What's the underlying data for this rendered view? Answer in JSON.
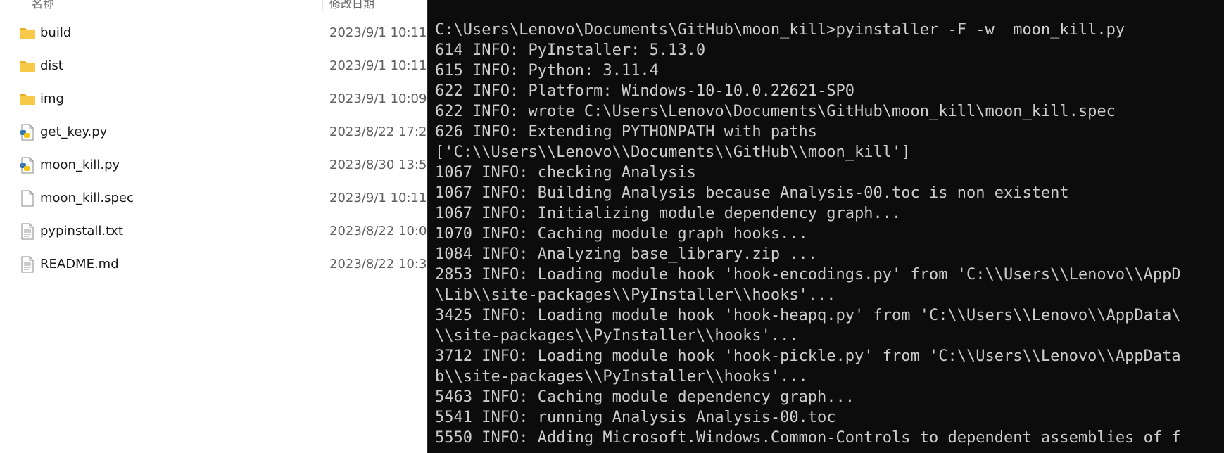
{
  "explorer": {
    "header": {
      "name_col": "名称",
      "date_col": "修改日期"
    },
    "files": [
      {
        "name": "build",
        "date": "2023/9/1 10:11",
        "icon": "folder-icon"
      },
      {
        "name": "dist",
        "date": "2023/9/1 10:11",
        "icon": "folder-icon"
      },
      {
        "name": "img",
        "date": "2023/9/1 10:09",
        "icon": "folder-icon"
      },
      {
        "name": "get_key.py",
        "date": "2023/8/22 17:2",
        "icon": "python-file-icon"
      },
      {
        "name": "moon_kill.py",
        "date": "2023/8/30 13:5",
        "icon": "python-file-icon"
      },
      {
        "name": "moon_kill.spec",
        "date": "2023/9/1 10:11",
        "icon": "file-icon"
      },
      {
        "name": "pypinstall.txt",
        "date": "2023/8/22 10:0",
        "icon": "text-file-icon"
      },
      {
        "name": "README.md",
        "date": "2023/8/22 10:3",
        "icon": "text-file-icon"
      }
    ],
    "colors": {
      "folder": "#f8c948",
      "folder_dark": "#e9b02a",
      "python_blue": "#3a76b0",
      "python_yellow": "#f5c518"
    }
  },
  "terminal": {
    "lines": [
      "C:\\Users\\Lenovo\\Documents\\GitHub\\moon_kill>pyinstaller -F -w  moon_kill.py",
      "614 INFO: PyInstaller: 5.13.0",
      "615 INFO: Python: 3.11.4",
      "622 INFO: Platform: Windows-10-10.0.22621-SP0",
      "622 INFO: wrote C:\\Users\\Lenovo\\Documents\\GitHub\\moon_kill\\moon_kill.spec",
      "626 INFO: Extending PYTHONPATH with paths",
      "['C:\\\\Users\\\\Lenovo\\\\Documents\\\\GitHub\\\\moon_kill']",
      "1067 INFO: checking Analysis",
      "1067 INFO: Building Analysis because Analysis-00.toc is non existent",
      "1067 INFO: Initializing module dependency graph...",
      "1070 INFO: Caching module graph hooks...",
      "1084 INFO: Analyzing base_library.zip ...",
      "2853 INFO: Loading module hook 'hook-encodings.py' from 'C:\\\\Users\\\\Lenovo\\\\AppD",
      "\\Lib\\\\site-packages\\\\PyInstaller\\\\hooks'...",
      "3425 INFO: Loading module hook 'hook-heapq.py' from 'C:\\\\Users\\\\Lenovo\\\\AppData\\",
      "\\\\site-packages\\\\PyInstaller\\\\hooks'...",
      "3712 INFO: Loading module hook 'hook-pickle.py' from 'C:\\\\Users\\\\Lenovo\\\\AppData",
      "b\\\\site-packages\\\\PyInstaller\\\\hooks'...",
      "5463 INFO: Caching module dependency graph...",
      "5541 INFO: running Analysis Analysis-00.toc",
      "5550 INFO: Adding Microsoft.Windows.Common-Controls to dependent assemblies of f"
    ],
    "colors": {
      "background": "#0c0c0c",
      "text": "#cccccc"
    }
  }
}
